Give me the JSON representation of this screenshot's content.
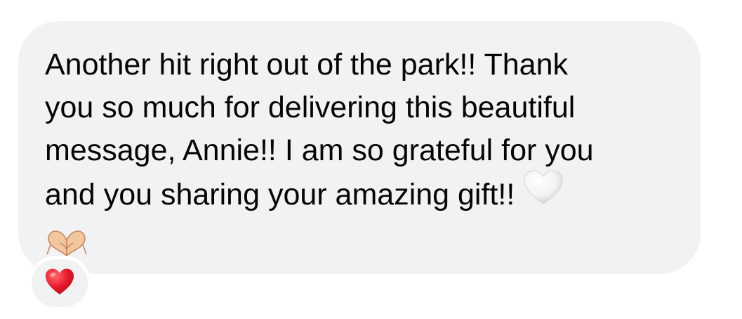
{
  "message": {
    "lines": [
      "Another hit right out of the park!! Thank",
      "you so much for delivering this beautiful",
      "message, Annie!! I am so grateful for you",
      "and you sharing your amazing gift!!"
    ],
    "inline_emoji": "white-heart-icon",
    "trailing_emoji": "heart-hands-icon"
  },
  "reaction": {
    "emoji": "red-heart-icon"
  },
  "colors": {
    "bubble_background": "#f1f2f4",
    "text": "#050505",
    "page_background": "#ffffff",
    "reaction_heart": "#e8192c"
  }
}
